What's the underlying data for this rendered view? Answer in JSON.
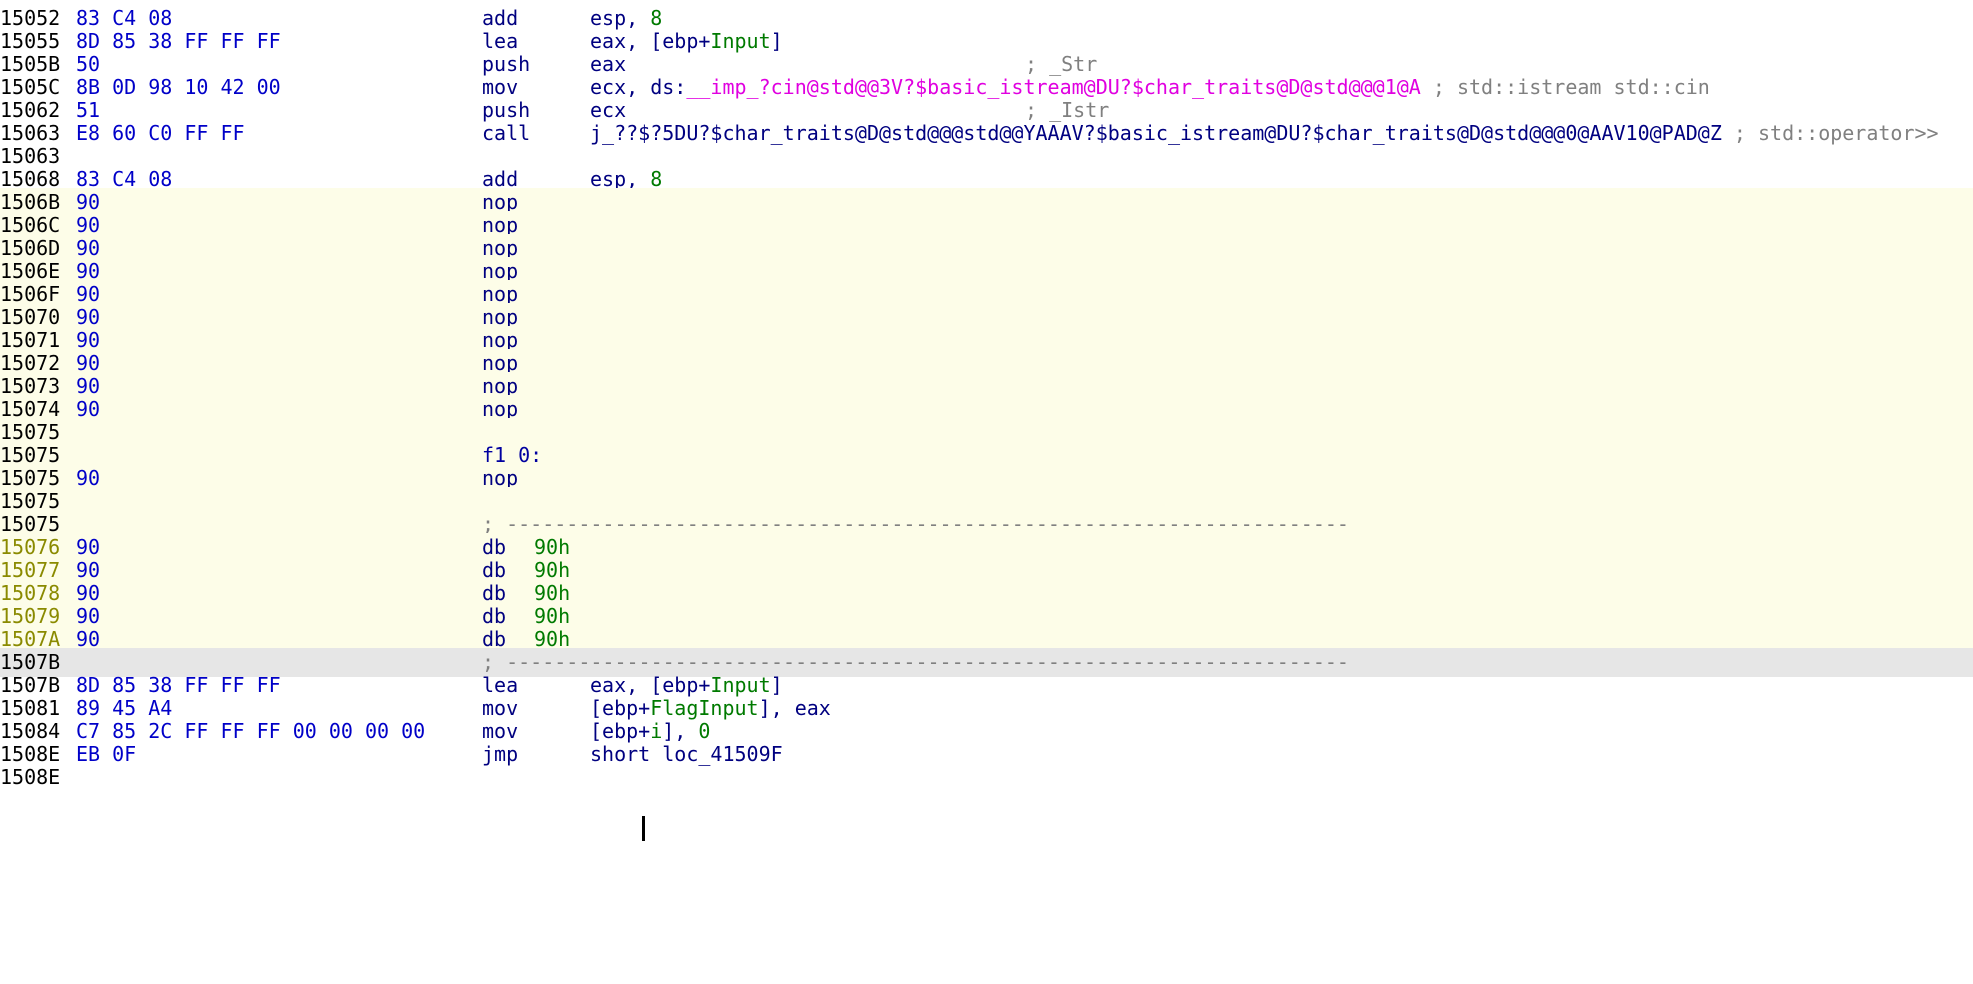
{
  "lines": [
    {
      "addr": "15052",
      "bytes": "83 C4 08",
      "mnem": "add",
      "op": "esp, ",
      "num": "8"
    },
    {
      "addr": "15055",
      "bytes": "8D 85 38 FF FF FF",
      "mnem": "lea",
      "op_pre": "eax, [ebp+",
      "var": "Input",
      "op_post": "]"
    },
    {
      "addr": "1505B",
      "bytes": "50",
      "mnem": "push",
      "op": "eax",
      "comment": "; _Str"
    },
    {
      "addr": "1505C",
      "bytes": "8B 0D 98 10 42 00",
      "mnem": "mov",
      "op": "ecx, ds:",
      "imp": "__imp_?cin@std@@3V?$basic_istream@DU?$char_traits@D@std@@@1@A",
      "tail": " ; std::istream std::cin"
    },
    {
      "addr": "15062",
      "bytes": "51",
      "mnem": "push",
      "op": "ecx",
      "comment": "; _Istr"
    },
    {
      "addr": "15063",
      "bytes": "E8 60 C0 FF FF",
      "mnem": "call",
      "op": "j_??$?5DU?$char_traits@D@std@@@std@@YAAAV?$basic_istream@DU?$char_traits@D@std@@@0@AAV10@PAD@Z",
      "tail": " ; std::operator>>"
    },
    {
      "addr": "15063"
    },
    {
      "addr": "15068",
      "bytes": "83 C4 08",
      "mnem": "add",
      "op": "esp, ",
      "num": "8"
    },
    {
      "addr": "1506B",
      "bytes": "90",
      "mnem": "nop"
    },
    {
      "addr": "1506C",
      "bytes": "90",
      "mnem": "nop"
    },
    {
      "addr": "1506D",
      "bytes": "90",
      "mnem": "nop"
    },
    {
      "addr": "1506E",
      "bytes": "90",
      "mnem": "nop"
    },
    {
      "addr": "1506F",
      "bytes": "90",
      "mnem": "nop"
    },
    {
      "addr": "15070",
      "bytes": "90",
      "mnem": "nop"
    },
    {
      "addr": "15071",
      "bytes": "90",
      "mnem": "nop"
    },
    {
      "addr": "15072",
      "bytes": "90",
      "mnem": "nop"
    },
    {
      "addr": "15073",
      "bytes": "90",
      "mnem": "nop"
    },
    {
      "addr": "15074",
      "bytes": "90",
      "mnem": "nop"
    },
    {
      "addr": "15075"
    },
    {
      "addr": "15075",
      "label": "f1_0:"
    },
    {
      "addr": "15075",
      "bytes": "90",
      "mnem": "nop"
    },
    {
      "addr": "15075"
    },
    {
      "addr": "15075",
      "divider": "; ----------------------------------------------------------------------"
    },
    {
      "addr": "15076",
      "bytes": "90",
      "mnem": "db",
      "num": "90h"
    },
    {
      "addr": "15077",
      "bytes": "90",
      "mnem": "db",
      "num": "90h"
    },
    {
      "addr": "15078",
      "bytes": "90",
      "mnem": "db",
      "num": "90h"
    },
    {
      "addr": "15079",
      "bytes": "90",
      "mnem": "db",
      "num": "90h"
    },
    {
      "addr": "1507A",
      "bytes": "90",
      "mnem": "db",
      "num": "90h"
    },
    {
      "addr": "1507B",
      "divider": "; ----------------------------------------------------------------------"
    },
    {
      "addr": "1507B",
      "bytes": "8D 85 38 FF FF FF",
      "mnem": "lea",
      "op_pre": "eax, [ebp+",
      "var": "Input",
      "op_post": "]"
    },
    {
      "addr": "15081",
      "bytes": "89 45 A4",
      "mnem": "mov",
      "op_pre": "[ebp+",
      "var": "FlagInput",
      "op_post": "], eax"
    },
    {
      "addr": "15084",
      "bytes": "C7 85 2C FF FF FF 00 00 00 00",
      "mnem": "mov",
      "op_pre": "[ebp+",
      "var": "i",
      "op_post": "], ",
      "num": "0"
    },
    {
      "addr": "1508E",
      "bytes": "EB 0F",
      "mnem": "jmp",
      "op": "short loc_41509F"
    },
    {
      "addr": "1508E"
    }
  ],
  "colors": {
    "yellow_region": "#fdfde8",
    "cursor_line": "#e6e6e6",
    "addr_default": "#000000",
    "addr_data": "#8a8a00",
    "bytes": "#0000c8",
    "numbers": "#007a00",
    "imports": "#e000e0",
    "comments": "#808080"
  }
}
